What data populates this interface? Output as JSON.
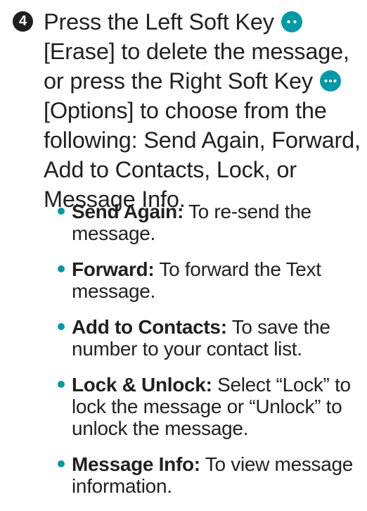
{
  "step": {
    "number": "4",
    "text_1": "Press the Left Soft Key",
    "text_2": "[Erase] to delete the message, or press the Right Soft Key",
    "text_3": "[Options] to choose from the following: Send Again, Forward, Add to Contacts, Lock, or Message Info."
  },
  "icons": {
    "left_softkey": "left-soft-key-icon",
    "right_softkey": "right-soft-key-icon"
  },
  "colors": {
    "accent": "#0099a8",
    "text": "#231f20"
  },
  "options": [
    {
      "term": "Send Again:",
      "description": "To re-send the message."
    },
    {
      "term": "Forward:",
      "description": "To forward the Text message."
    },
    {
      "term": "Add to Contacts:",
      "description": "To save the number to your contact list."
    },
    {
      "term": "Lock & Unlock:",
      "description": "Select “Lock” to lock the message or “Unlock” to unlock the message."
    },
    {
      "term": "Message Info:",
      "description": "To view message information."
    }
  ]
}
